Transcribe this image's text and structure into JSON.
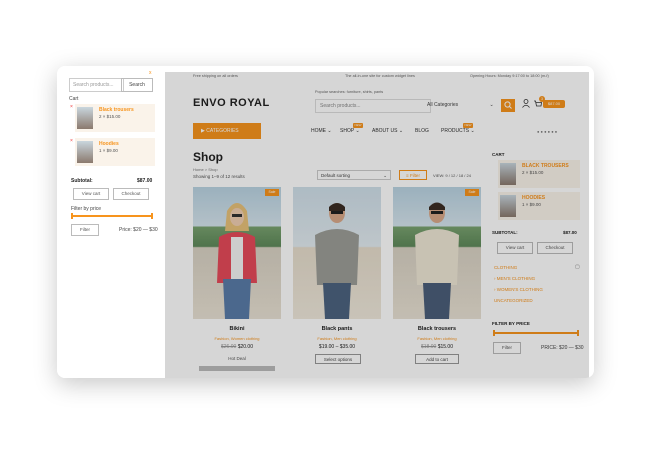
{
  "side_panel": {
    "search_placeholder": "Search products...",
    "search_button": "Search",
    "close": "x",
    "cart_heading": "Cart",
    "items": [
      {
        "name": "Black trousers",
        "qty": "2 × $15.00"
      },
      {
        "name": "Hoodies",
        "qty": "1 × $9.00"
      }
    ],
    "subtotal_label": "Subtotal:",
    "subtotal_value": "$87.00",
    "view_cart": "View cart",
    "checkout": "Checkout",
    "filter_heading": "Filter by price",
    "filter_button": "Filter",
    "price_range": "Price: $20 — $30"
  },
  "main": {
    "topbar": {
      "left": "Free shipping on all orders",
      "center": "The all-in-one site for custom widget lines",
      "right": "Opening Hours: Monday 9:17:00 to 18:00 (m-f)"
    },
    "logo": "ENVO ROYAL",
    "keywords": "Popular searches: furniture, shirts, pants",
    "search_placeholder": "Search products...",
    "category_select": "All Categories",
    "cart_price": "$87.00",
    "cart_count": "3",
    "categories_button": "CATEGORIES",
    "nav": [
      {
        "label": "HOME"
      },
      {
        "label": "SHOP",
        "badge": "NEW"
      },
      {
        "label": "ABOUT US"
      },
      {
        "label": "BLOG"
      },
      {
        "label": "PRODUCTS",
        "badge": "NEW"
      }
    ],
    "page_title": "Shop",
    "breadcrumb": "Home > Shop",
    "showing": "Showing 1–9 of 12 results",
    "sort": "Default sorting",
    "filter_button": "Filter",
    "view_label": "VIEW: 9 / 12 / 18 / 24",
    "products": [
      {
        "title": "Bikini",
        "category": "Fashion, Women clothing",
        "old_price": "$26.00",
        "price": "$20.00",
        "action": "Hot Deal",
        "badge": "Sale"
      },
      {
        "title": "Black pants",
        "category": "Fashion, Men clothing",
        "old_price": "",
        "price": "$19.00 – $35.00",
        "action": "Select options",
        "badge": ""
      },
      {
        "title": "Black trousers",
        "category": "Fashion, Men clothing",
        "old_price": "$18.00",
        "price": "$15.00",
        "action": "Add to cart",
        "badge": "Sale"
      }
    ],
    "sidebar": {
      "cart_heading": "CART",
      "items": [
        {
          "name": "BLACK TROUSERS",
          "qty": "2 × $15.00"
        },
        {
          "name": "HOODIES",
          "qty": "1 × $9.00"
        }
      ],
      "subtotal_label": "SUBTOTAL:",
      "subtotal_value": "$87.00",
      "view_cart": "View cart",
      "checkout": "Checkout",
      "links": [
        "CLOTHING",
        "MEN'S CLOTHING",
        "WOMEN'S CLOTHING",
        "UNCATEGORIZED"
      ],
      "filter_heading": "FILTER BY PRICE",
      "filter_button": "Filter",
      "price_range": "PRICE: $20 — $30"
    }
  },
  "colors": {
    "accent": "#f7941d",
    "overlay": "rgba(0,0,0,0.16)"
  }
}
